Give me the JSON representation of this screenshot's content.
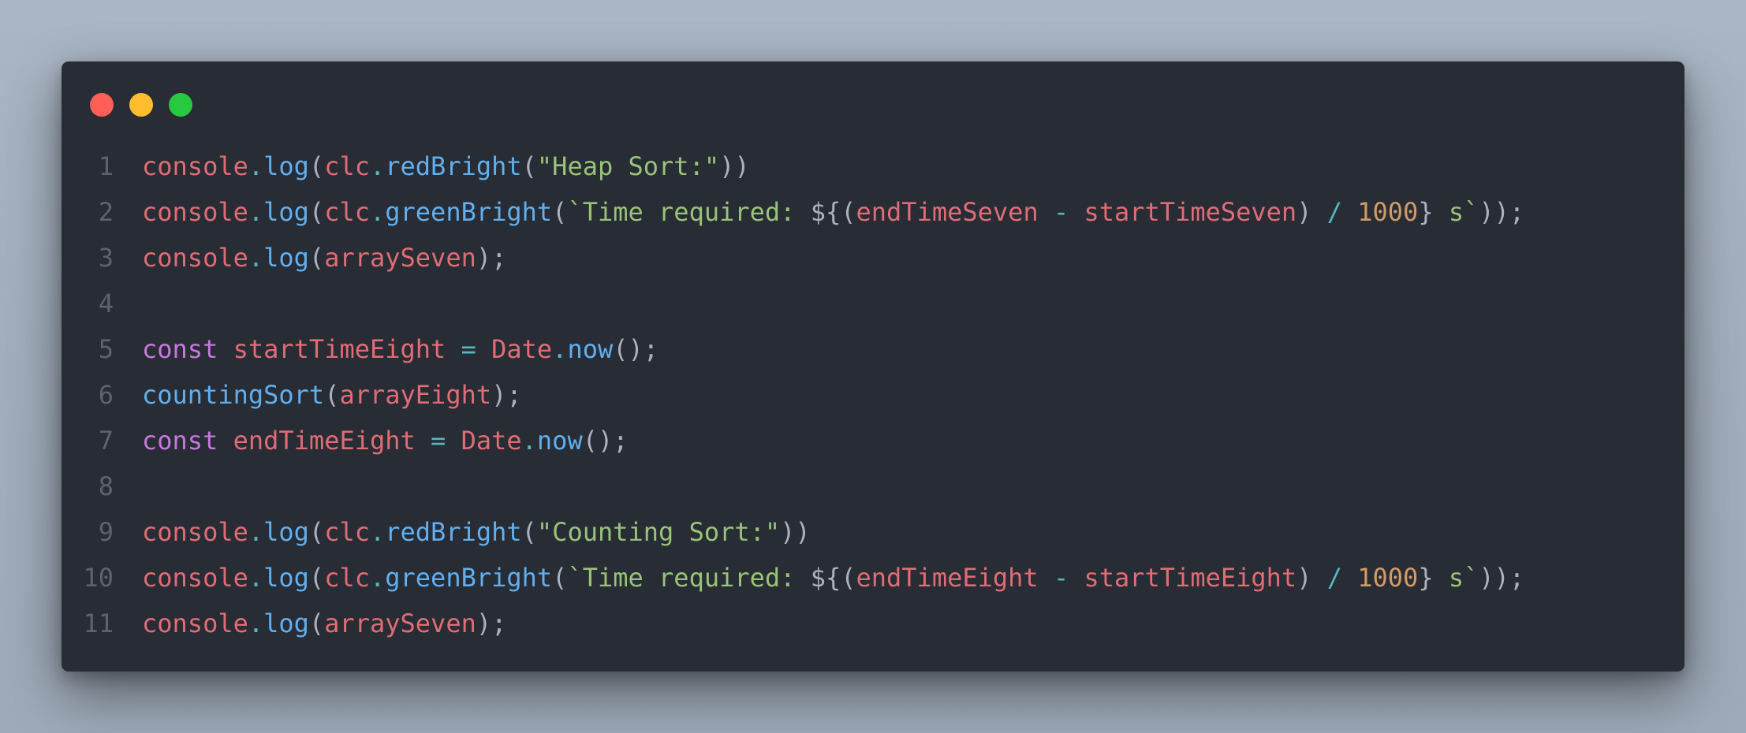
{
  "window": {
    "controls": [
      {
        "name": "close-dot",
        "color": "#ff5f56"
      },
      {
        "name": "minimize-dot",
        "color": "#ffbd2e"
      },
      {
        "name": "maximize-dot",
        "color": "#27c93f"
      }
    ]
  },
  "colors": {
    "fg": "#abb2bf",
    "var": "#e06c75",
    "fn": "#61afef",
    "kw": "#c678dd",
    "str": "#98c379",
    "num": "#d19a66",
    "op": "#56b6c2"
  },
  "code": {
    "lines": [
      {
        "n": "1",
        "tokens": [
          {
            "t": "console",
            "c": "var"
          },
          {
            "t": ".",
            "c": "op"
          },
          {
            "t": "log",
            "c": "fn"
          },
          {
            "t": "(",
            "c": "fg"
          },
          {
            "t": "clc",
            "c": "var"
          },
          {
            "t": ".",
            "c": "op"
          },
          {
            "t": "redBright",
            "c": "fn"
          },
          {
            "t": "(",
            "c": "fg"
          },
          {
            "t": "\"Heap Sort:\"",
            "c": "str"
          },
          {
            "t": "))",
            "c": "fg"
          }
        ]
      },
      {
        "n": "2",
        "tokens": [
          {
            "t": "console",
            "c": "var"
          },
          {
            "t": ".",
            "c": "op"
          },
          {
            "t": "log",
            "c": "fn"
          },
          {
            "t": "(",
            "c": "fg"
          },
          {
            "t": "clc",
            "c": "var"
          },
          {
            "t": ".",
            "c": "op"
          },
          {
            "t": "greenBright",
            "c": "fn"
          },
          {
            "t": "(",
            "c": "fg"
          },
          {
            "t": "`Time required: ",
            "c": "str"
          },
          {
            "t": "${(",
            "c": "fg"
          },
          {
            "t": "endTimeSeven",
            "c": "var"
          },
          {
            "t": " - ",
            "c": "op"
          },
          {
            "t": "startTimeSeven",
            "c": "var"
          },
          {
            "t": ")",
            "c": "fg"
          },
          {
            "t": " / ",
            "c": "op"
          },
          {
            "t": "1000",
            "c": "num"
          },
          {
            "t": "}",
            "c": "fg"
          },
          {
            "t": " s`",
            "c": "str"
          },
          {
            "t": "));",
            "c": "fg"
          }
        ]
      },
      {
        "n": "3",
        "tokens": [
          {
            "t": "console",
            "c": "var"
          },
          {
            "t": ".",
            "c": "op"
          },
          {
            "t": "log",
            "c": "fn"
          },
          {
            "t": "(",
            "c": "fg"
          },
          {
            "t": "arraySeven",
            "c": "var"
          },
          {
            "t": ");",
            "c": "fg"
          }
        ]
      },
      {
        "n": "4",
        "tokens": []
      },
      {
        "n": "5",
        "tokens": [
          {
            "t": "const",
            "c": "kw"
          },
          {
            "t": " ",
            "c": "fg"
          },
          {
            "t": "startTimeEight",
            "c": "var"
          },
          {
            "t": " = ",
            "c": "op"
          },
          {
            "t": "Date",
            "c": "var"
          },
          {
            "t": ".",
            "c": "op"
          },
          {
            "t": "now",
            "c": "fn"
          },
          {
            "t": "();",
            "c": "fg"
          }
        ]
      },
      {
        "n": "6",
        "tokens": [
          {
            "t": "countingSort",
            "c": "fn"
          },
          {
            "t": "(",
            "c": "fg"
          },
          {
            "t": "arrayEight",
            "c": "var"
          },
          {
            "t": ");",
            "c": "fg"
          }
        ]
      },
      {
        "n": "7",
        "tokens": [
          {
            "t": "const",
            "c": "kw"
          },
          {
            "t": " ",
            "c": "fg"
          },
          {
            "t": "endTimeEight",
            "c": "var"
          },
          {
            "t": " = ",
            "c": "op"
          },
          {
            "t": "Date",
            "c": "var"
          },
          {
            "t": ".",
            "c": "op"
          },
          {
            "t": "now",
            "c": "fn"
          },
          {
            "t": "();",
            "c": "fg"
          }
        ]
      },
      {
        "n": "8",
        "tokens": []
      },
      {
        "n": "9",
        "tokens": [
          {
            "t": "console",
            "c": "var"
          },
          {
            "t": ".",
            "c": "op"
          },
          {
            "t": "log",
            "c": "fn"
          },
          {
            "t": "(",
            "c": "fg"
          },
          {
            "t": "clc",
            "c": "var"
          },
          {
            "t": ".",
            "c": "op"
          },
          {
            "t": "redBright",
            "c": "fn"
          },
          {
            "t": "(",
            "c": "fg"
          },
          {
            "t": "\"Counting Sort:\"",
            "c": "str"
          },
          {
            "t": "))",
            "c": "fg"
          }
        ]
      },
      {
        "n": "10",
        "tokens": [
          {
            "t": "console",
            "c": "var"
          },
          {
            "t": ".",
            "c": "op"
          },
          {
            "t": "log",
            "c": "fn"
          },
          {
            "t": "(",
            "c": "fg"
          },
          {
            "t": "clc",
            "c": "var"
          },
          {
            "t": ".",
            "c": "op"
          },
          {
            "t": "greenBright",
            "c": "fn"
          },
          {
            "t": "(",
            "c": "fg"
          },
          {
            "t": "`Time required: ",
            "c": "str"
          },
          {
            "t": "${(",
            "c": "fg"
          },
          {
            "t": "endTimeEight",
            "c": "var"
          },
          {
            "t": " - ",
            "c": "op"
          },
          {
            "t": "startTimeEight",
            "c": "var"
          },
          {
            "t": ")",
            "c": "fg"
          },
          {
            "t": " / ",
            "c": "op"
          },
          {
            "t": "1000",
            "c": "num"
          },
          {
            "t": "}",
            "c": "fg"
          },
          {
            "t": " s`",
            "c": "str"
          },
          {
            "t": "));",
            "c": "fg"
          }
        ]
      },
      {
        "n": "11",
        "tokens": [
          {
            "t": "console",
            "c": "var"
          },
          {
            "t": ".",
            "c": "op"
          },
          {
            "t": "log",
            "c": "fn"
          },
          {
            "t": "(",
            "c": "fg"
          },
          {
            "t": "arraySeven",
            "c": "var"
          },
          {
            "t": ");",
            "c": "fg"
          }
        ]
      }
    ]
  }
}
